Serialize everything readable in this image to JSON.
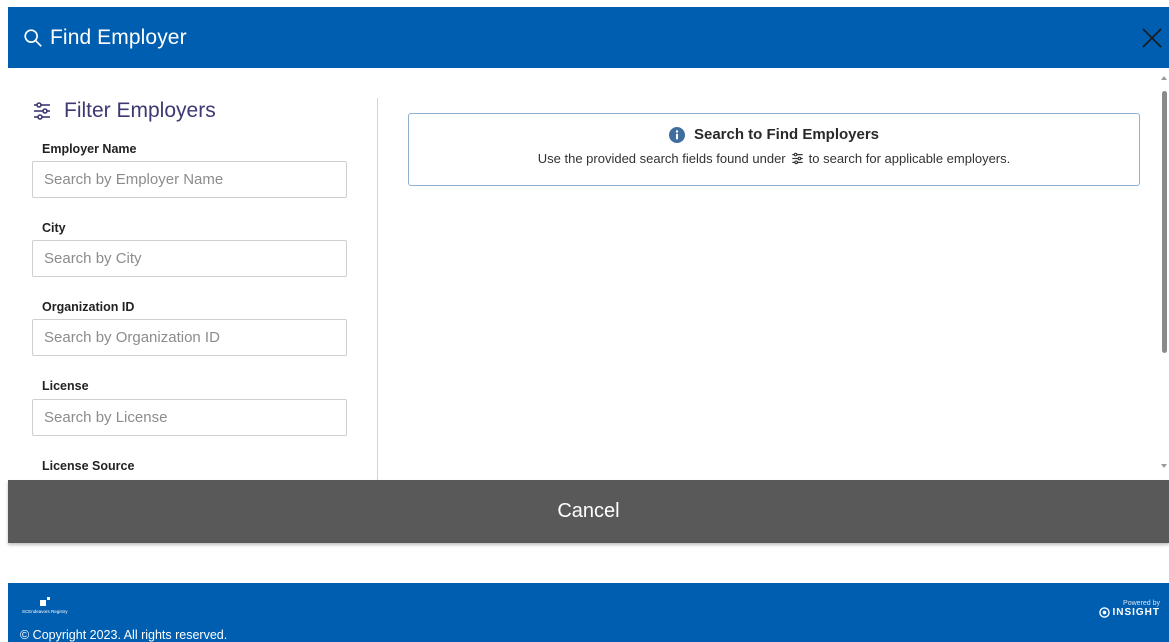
{
  "header": {
    "title": "Find Employer",
    "search_icon": "search-icon",
    "close_icon": "close-icon",
    "background_color": "#005eb0"
  },
  "filters": {
    "heading": "Filter Employers",
    "heading_icon": "sliders-icon",
    "fields": [
      {
        "label": "Employer Name",
        "placeholder": "Search by Employer Name",
        "value": ""
      },
      {
        "label": "City",
        "placeholder": "Search by City",
        "value": ""
      },
      {
        "label": "Organization ID",
        "placeholder": "Search by Organization ID",
        "value": ""
      },
      {
        "label": "License",
        "placeholder": "Search by License",
        "value": ""
      },
      {
        "label": "License Source"
      }
    ]
  },
  "info": {
    "icon": "info-icon",
    "title": "Search to Find Employers",
    "text_before": "Use the provided search fields found under",
    "text_after": "to search for applicable employers."
  },
  "actions": {
    "cancel_label": "Cancel",
    "cancel_color": "#595959"
  },
  "footer": {
    "logo_text": "SCEndeavors Registry",
    "copyright": "© Copyright 2023. All rights reserved.",
    "powered_by": "Powered by",
    "brand": "INSIGHT"
  }
}
